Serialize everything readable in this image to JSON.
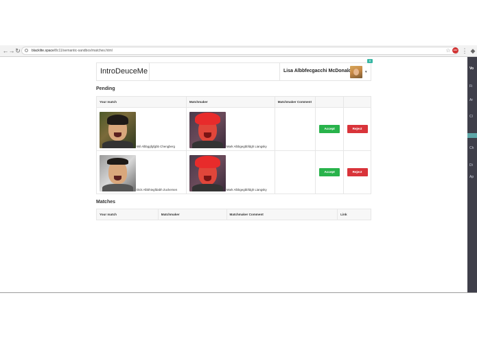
{
  "browser": {
    "url_host": "blacklite.space",
    "url_path": "/8c11/semantic-sandbox/matches.html",
    "ext_label": "ABP"
  },
  "side_panel": {
    "lines": [
      "Vo",
      "Fi",
      "Ar",
      "Cl",
      "Ch",
      "Di",
      "Ap"
    ]
  },
  "navbar": {
    "brand": "IntroDeuceMe",
    "user_name": "Lisa Albbfecgacchi McDonaldberg",
    "badge": "8",
    "caret": "▾"
  },
  "pending": {
    "title": "Pending",
    "headers": [
      "Your match",
      "Matchmaker",
      "Matchmaker Comment",
      "",
      ""
    ],
    "accept_label": "Accept",
    "reject_label": "Reject",
    "rows": [
      {
        "your_match": "Wil Albbggfgfgbb Chengberg",
        "matchmaker": "Mark Albbgegbbfdgh Liangsky",
        "comment": ""
      },
      {
        "your_match": "Dick Albbhiegfdabh Zuckersen",
        "matchmaker": "Mark Albbgegbbfdgh Liangsky",
        "comment": ""
      }
    ]
  },
  "matches": {
    "title": "Matches",
    "headers": [
      "Your match",
      "Matchmaker",
      "Matchmaker Comment",
      "Link"
    ]
  },
  "colors": {
    "accept": "#28b34b",
    "reject": "#d9343a",
    "badge": "#38b7a4"
  }
}
